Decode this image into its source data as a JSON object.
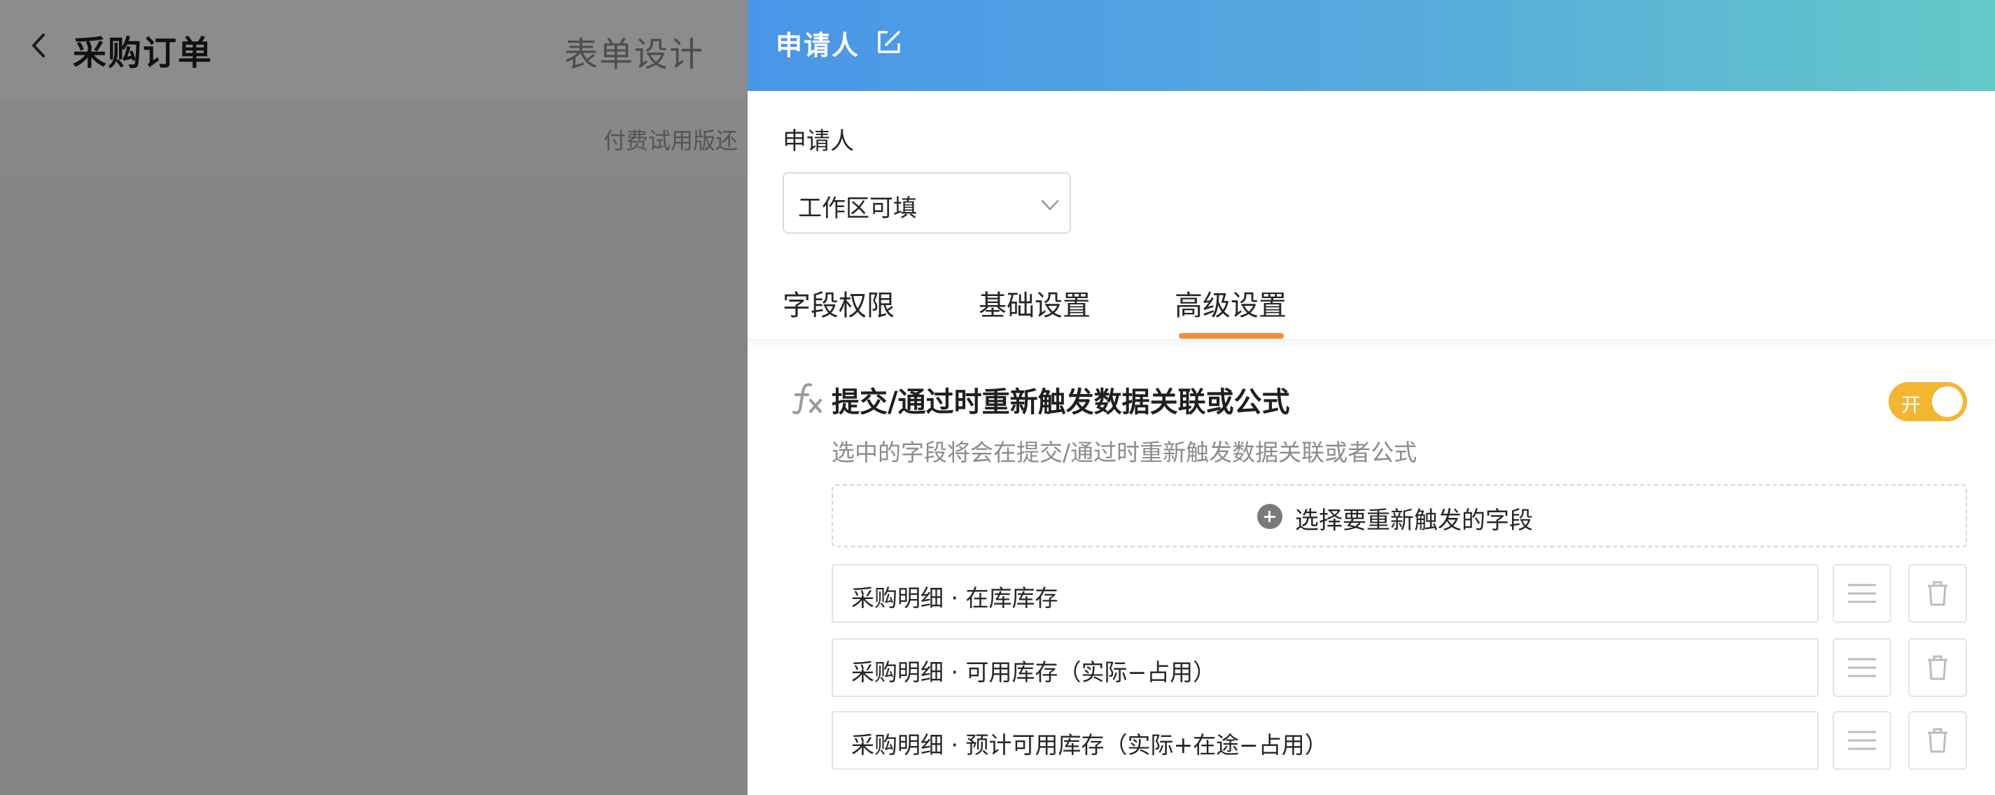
{
  "background": {
    "page_title": "采购订单",
    "active_tab": "表单设计",
    "notice_text": "付费试用版还"
  },
  "drawer": {
    "title": "申请人",
    "field_label": "申请人",
    "permission_select": {
      "value": "工作区可填"
    },
    "tabs": [
      {
        "label": "字段权限",
        "active": false
      },
      {
        "label": "基础设置",
        "active": false
      },
      {
        "label": "高级设置",
        "active": true
      }
    ],
    "advanced": {
      "title": "提交/通过时重新触发数据关联或公式",
      "description": "选中的字段将会在提交/通过时重新触发数据关联或者公式",
      "toggle": {
        "label": "开",
        "on": true
      },
      "add_button": "选择要重新触发的字段",
      "fields": [
        "采购明细 · 在库库存",
        "采购明细 · 可用库存（实际−占用）",
        "采购明细 · 预计可用库存（实际+在途−占用）"
      ]
    }
  },
  "colors": {
    "header_gradient_start": "#4a95e8",
    "header_gradient_end": "#63c9c8",
    "tab_indicator": "#f08f3a",
    "toggle_on": "#f2b632"
  },
  "icons": {
    "back": "chevron-left-icon",
    "edit": "edit-icon",
    "select_arrow": "chevron-down-icon",
    "formula": "fx-icon",
    "add": "plus-circle-icon",
    "drag": "drag-handle-icon",
    "delete": "trash-icon"
  }
}
